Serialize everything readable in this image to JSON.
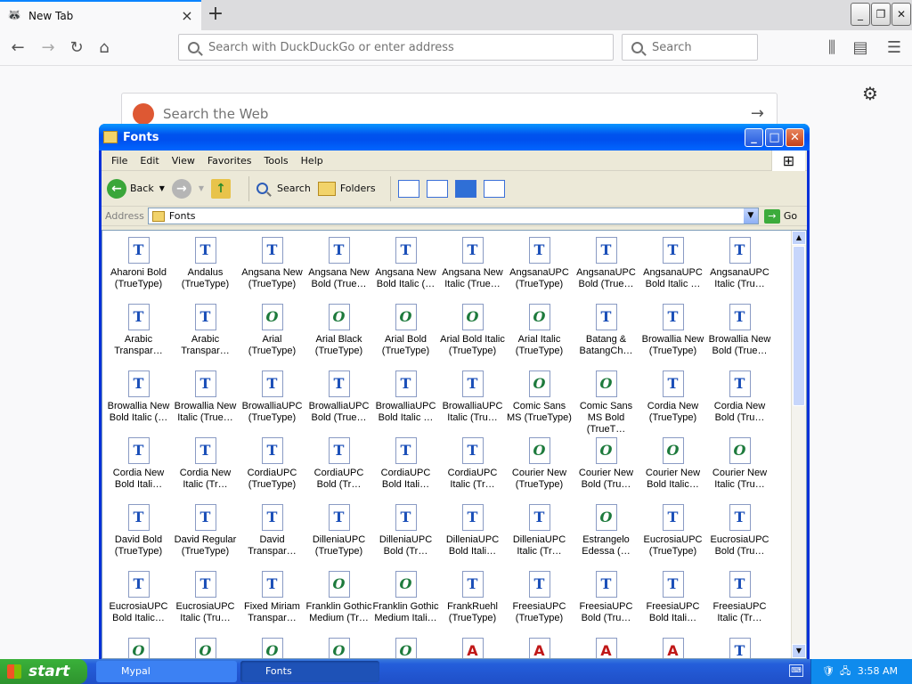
{
  "browser": {
    "tab_title": "New Tab",
    "url_placeholder": "Search with DuckDuckGo or enter address",
    "search_placeholder": "Search",
    "ddg_placeholder": "Search the Web"
  },
  "window": {
    "title": "Fonts",
    "menu": [
      "File",
      "Edit",
      "View",
      "Favorites",
      "Tools",
      "Help"
    ],
    "toolbar": {
      "back": "Back",
      "search": "Search",
      "folders": "Folders"
    },
    "address_label": "Address",
    "address_value": "Fonts",
    "go_label": "Go"
  },
  "icons": [
    {
      "name": "Aharoni Bold (TrueType)",
      "kind": "tt"
    },
    {
      "name": "Andalus (TrueType)",
      "kind": "tt"
    },
    {
      "name": "Angsana New (TrueType)",
      "kind": "tt"
    },
    {
      "name": "Angsana New Bold (True…",
      "kind": "tt"
    },
    {
      "name": "Angsana New Bold Italic (…",
      "kind": "tt"
    },
    {
      "name": "Angsana New Italic (True…",
      "kind": "tt"
    },
    {
      "name": "AngsanaUPC (TrueType)",
      "kind": "tt"
    },
    {
      "name": "AngsanaUPC Bold (True…",
      "kind": "tt"
    },
    {
      "name": "AngsanaUPC Bold Italic …",
      "kind": "tt"
    },
    {
      "name": "AngsanaUPC Italic (Tru…",
      "kind": "tt"
    },
    {
      "name": "Arabic Transpar…",
      "kind": "tt"
    },
    {
      "name": "Arabic Transpar…",
      "kind": "tt"
    },
    {
      "name": "Arial (TrueType)",
      "kind": "ot"
    },
    {
      "name": "Arial Black (TrueType)",
      "kind": "ot"
    },
    {
      "name": "Arial Bold (TrueType)",
      "kind": "ot"
    },
    {
      "name": "Arial Bold Italic (TrueType)",
      "kind": "ot"
    },
    {
      "name": "Arial Italic (TrueType)",
      "kind": "ot"
    },
    {
      "name": "Batang & BatangCh…",
      "kind": "tt"
    },
    {
      "name": "Browallia New (TrueType)",
      "kind": "tt"
    },
    {
      "name": "Browallia New Bold (True…",
      "kind": "tt"
    },
    {
      "name": "Browallia New Bold Italic (…",
      "kind": "tt"
    },
    {
      "name": "Browallia New Italic (True…",
      "kind": "tt"
    },
    {
      "name": "BrowalliaUPC (TrueType)",
      "kind": "tt"
    },
    {
      "name": "BrowalliaUPC Bold (True…",
      "kind": "tt"
    },
    {
      "name": "BrowalliaUPC Bold Italic …",
      "kind": "tt"
    },
    {
      "name": "BrowalliaUPC Italic (Tru…",
      "kind": "tt"
    },
    {
      "name": "Comic Sans MS (TrueType)",
      "kind": "ot"
    },
    {
      "name": "Comic Sans MS Bold (TrueT…",
      "kind": "ot"
    },
    {
      "name": "Cordia New (TrueType)",
      "kind": "tt"
    },
    {
      "name": "Cordia New Bold (Tru…",
      "kind": "tt"
    },
    {
      "name": "Cordia New Bold Itali…",
      "kind": "tt"
    },
    {
      "name": "Cordia New Italic (Tr…",
      "kind": "tt"
    },
    {
      "name": "CordiaUPC (TrueType)",
      "kind": "tt"
    },
    {
      "name": "CordiaUPC Bold (Tr…",
      "kind": "tt"
    },
    {
      "name": "CordiaUPC Bold Itali…",
      "kind": "tt"
    },
    {
      "name": "CordiaUPC Italic (Tr…",
      "kind": "tt"
    },
    {
      "name": "Courier New (TrueType)",
      "kind": "ot"
    },
    {
      "name": "Courier New Bold (Tru…",
      "kind": "ot"
    },
    {
      "name": "Courier New Bold Italic…",
      "kind": "ot"
    },
    {
      "name": "Courier New Italic (Tru…",
      "kind": "ot"
    },
    {
      "name": "David Bold (TrueType)",
      "kind": "tt"
    },
    {
      "name": "David Regular (TrueType)",
      "kind": "tt"
    },
    {
      "name": "David Transpar…",
      "kind": "tt"
    },
    {
      "name": "DilleniaUPC (TrueType)",
      "kind": "tt"
    },
    {
      "name": "DilleniaUPC Bold (Tr…",
      "kind": "tt"
    },
    {
      "name": "DilleniaUPC Bold Itali…",
      "kind": "tt"
    },
    {
      "name": "DilleniaUPC Italic (Tr…",
      "kind": "tt"
    },
    {
      "name": "Estrangelo Edessa (…",
      "kind": "ot"
    },
    {
      "name": "EucrosiaUPC (TrueType)",
      "kind": "tt"
    },
    {
      "name": "EucrosiaUPC Bold (Tru…",
      "kind": "tt"
    },
    {
      "name": "EucrosiaUPC Bold Italic…",
      "kind": "tt"
    },
    {
      "name": "EucrosiaUPC Italic (Tru…",
      "kind": "tt"
    },
    {
      "name": "Fixed Miriam Transpar…",
      "kind": "tt"
    },
    {
      "name": "Franklin Gothic Medium (Tr…",
      "kind": "ot"
    },
    {
      "name": "Franklin Gothic Medium Itali…",
      "kind": "ot"
    },
    {
      "name": "FrankRuehl (TrueType)",
      "kind": "tt"
    },
    {
      "name": "FreesiaUPC (TrueType)",
      "kind": "tt"
    },
    {
      "name": "FreesiaUPC Bold (Tru…",
      "kind": "tt"
    },
    {
      "name": "FreesiaUPC Bold Itali…",
      "kind": "tt"
    },
    {
      "name": "FreesiaUPC Italic (Tr…",
      "kind": "tt"
    },
    {
      "name": "",
      "kind": "ot"
    },
    {
      "name": "",
      "kind": "ot"
    },
    {
      "name": "",
      "kind": "ot"
    },
    {
      "name": "",
      "kind": "ot"
    },
    {
      "name": "",
      "kind": "ot"
    },
    {
      "name": "",
      "kind": "raster"
    },
    {
      "name": "",
      "kind": "raster"
    },
    {
      "name": "",
      "kind": "raster"
    },
    {
      "name": "",
      "kind": "raster"
    },
    {
      "name": "",
      "kind": "tt"
    }
  ],
  "glyphs": {
    "tt": "T",
    "ot": "O",
    "raster": "A"
  },
  "taskbar": {
    "start_label": "start",
    "tasks": [
      "Mypal",
      "Fonts"
    ],
    "clock": "3:58 AM"
  }
}
